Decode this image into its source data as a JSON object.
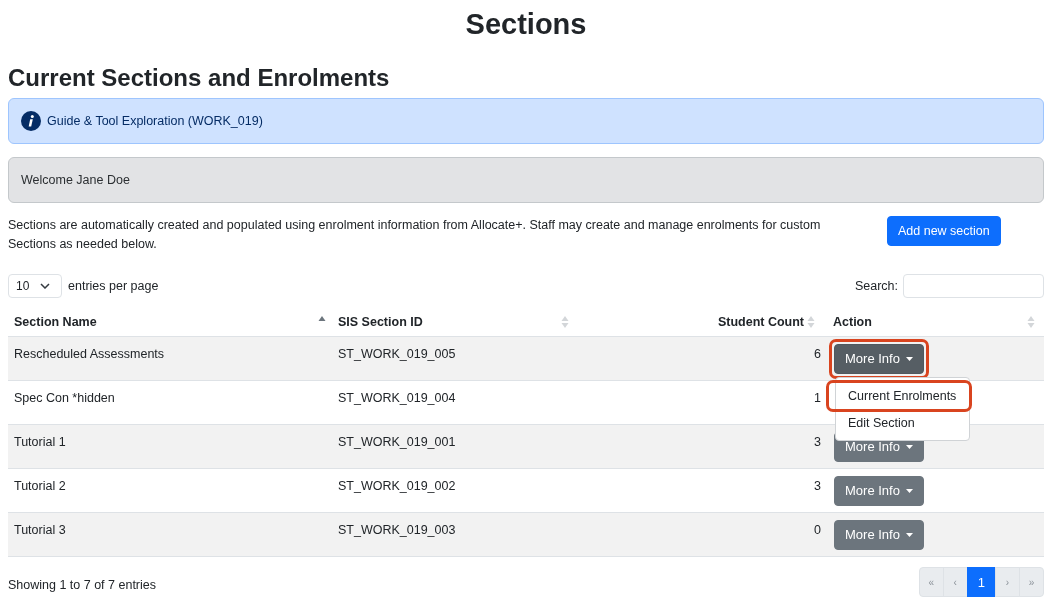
{
  "page_title": "Sections",
  "heading": "Current Sections and Enrolments",
  "course_alert": {
    "text": "Guide & Tool Exploration (WORK_019)"
  },
  "welcome_panel": {
    "text": "Welcome Jane Doe"
  },
  "description": "Sections are automatically created and populated using enrolment information from Allocate+. Staff may create and manage enrolments for custom Sections as needed below.",
  "add_section_button": {
    "label": "Add new section"
  },
  "page_length": {
    "value": "10",
    "label": "entries per page"
  },
  "search": {
    "label": "Search:"
  },
  "table": {
    "columns": [
      {
        "label": "Section Name",
        "kind": "text",
        "sorted": true
      },
      {
        "label": "SIS Section ID",
        "kind": "text",
        "sorted": false
      },
      {
        "label": "Student Count",
        "kind": "number",
        "sorted": false
      },
      {
        "label": "Action",
        "kind": "action",
        "sorted": false
      }
    ],
    "rows": [
      {
        "section_name": "Rescheduled Assessments",
        "sis_section_id": "ST_WORK_019_005",
        "student_count": "6",
        "action": {
          "label": "More Info",
          "expanded": true,
          "highlighted": true
        }
      },
      {
        "section_name": "Spec Con *hidden",
        "sis_section_id": "ST_WORK_019_004",
        "student_count": "1"
      },
      {
        "section_name": "Tutorial 1",
        "sis_section_id": "ST_WORK_019_001",
        "student_count": "3",
        "action": {
          "label": "More Info",
          "expanded": false,
          "highlighted": false
        }
      },
      {
        "section_name": "Tutorial 2",
        "sis_section_id": "ST_WORK_019_002",
        "student_count": "3",
        "action": {
          "label": "More Info",
          "expanded": false,
          "highlighted": false
        }
      },
      {
        "section_name": "Tutorial 3",
        "sis_section_id": "ST_WORK_019_003",
        "student_count": "0",
        "action": {
          "label": "More Info",
          "expanded": false,
          "highlighted": false
        }
      }
    ],
    "action_menu": {
      "items": [
        {
          "label": "Current Enrolments",
          "highlighted": true
        },
        {
          "label": "Edit Section",
          "highlighted": false
        }
      ]
    }
  },
  "footer": {
    "info": "Showing 1 to 7 of 7 entries",
    "pagination": [
      {
        "label": "«",
        "selected": false,
        "disabled": true
      },
      {
        "label": "‹",
        "selected": false,
        "disabled": true
      },
      {
        "label": "1",
        "selected": true,
        "disabled": false
      },
      {
        "label": "›",
        "selected": false,
        "disabled": true
      },
      {
        "label": "»",
        "selected": false,
        "disabled": true
      }
    ]
  }
}
